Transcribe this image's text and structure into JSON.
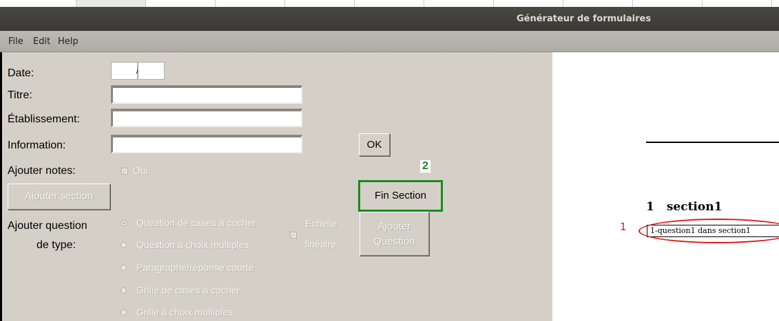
{
  "window": {
    "title": "Générateur de formulaires"
  },
  "menu": {
    "file": "File",
    "edit": "Edit",
    "help": "Help"
  },
  "form": {
    "date_label": "Date:",
    "date_separator": "/",
    "titre_label": "Titre:",
    "etablissement_label": "Établissement:",
    "information_label": "Information:",
    "ajouter_notes_label": "Ajouter notes:",
    "oui_label": "Oui",
    "ajouter_section_button": "Ajouter section",
    "ajouter_question_label_line1": "Ajouter question",
    "ajouter_question_label_line2": "de type:",
    "question_types": [
      {
        "label": "Question de cases à cocher",
        "selected": true
      },
      {
        "label": "Question à choix multiples",
        "selected": false
      },
      {
        "label": "Paragraphe/réponse courte",
        "selected": false
      },
      {
        "label": "Grille de cases à cocher",
        "selected": false
      },
      {
        "label": "Grille à choix multiples",
        "selected": false
      }
    ],
    "echelle_line1": "Échelle",
    "echelle_line2": "linéaire",
    "ajouter_question_button_line1": "Ajouter",
    "ajouter_question_button_line2": "Question",
    "ok_button": "OK",
    "fin_section_button": "Fin Section"
  },
  "annotations": {
    "green_marker": "2",
    "red_marker": "1"
  },
  "preview": {
    "section_number": "1",
    "section_title": "section1",
    "question_text": "1-question1 dans section1"
  },
  "colors": {
    "annotation_green": "#1a8a1a",
    "annotation_red": "#e01818",
    "titlebar": "#3f3d39"
  }
}
